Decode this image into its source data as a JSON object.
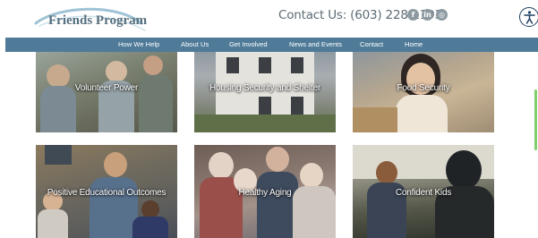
{
  "header": {
    "logo_text": "Friends Program",
    "contact_text": "Contact Us: (603) 228-1193",
    "social": [
      {
        "icon": "facebook-icon",
        "glyph": "f"
      },
      {
        "icon": "linkedin-icon",
        "glyph": "in"
      },
      {
        "icon": "instagram-icon",
        "glyph": "◎"
      }
    ],
    "accessibility_icon": "accessibility-icon"
  },
  "nav": {
    "items": [
      {
        "label": "How We Help"
      },
      {
        "label": "About Us"
      },
      {
        "label": "Get Involved"
      },
      {
        "label": "News and Events"
      },
      {
        "label": "Contact"
      },
      {
        "label": "Home"
      }
    ]
  },
  "tiles": [
    {
      "label": "Volunteer Power"
    },
    {
      "label": "Housing Security and Shelter"
    },
    {
      "label": "Food Security"
    },
    {
      "label": "Positive Educational Outcomes"
    },
    {
      "label": "Healthy Aging"
    },
    {
      "label": "Confident Kids"
    }
  ],
  "colors": {
    "nav_bg": "#4f7b99",
    "logo_text": "#556f7e",
    "contact_text": "#5c6b74",
    "scroll_accent": "#7fcf6a"
  }
}
